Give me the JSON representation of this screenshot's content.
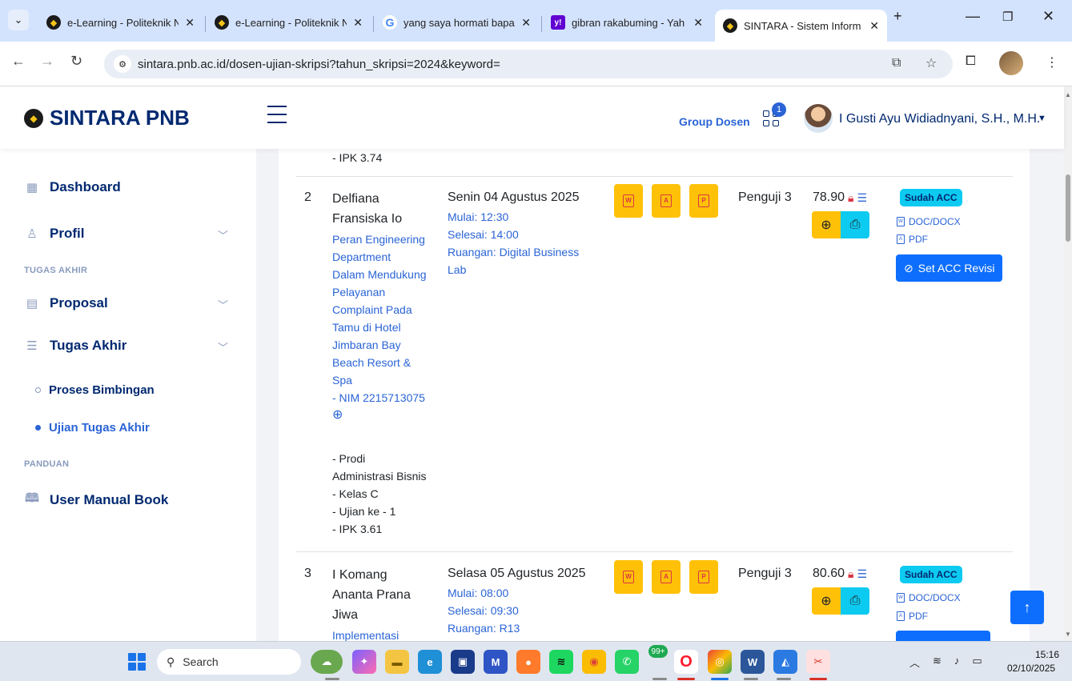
{
  "browser": {
    "tabs": [
      {
        "title": "e-Learning - Politeknik N",
        "icon": "pnb-logo-icon"
      },
      {
        "title": "e-Learning - Politeknik N",
        "icon": "pnb-logo-icon"
      },
      {
        "title": "yang saya hormati bapak",
        "icon": "google-icon"
      },
      {
        "title": "gibran rakabuming - Yah",
        "icon": "yahoo-icon"
      },
      {
        "title": "SINTARA - Sistem Inform",
        "icon": "pnb-logo-icon"
      }
    ],
    "url": "sintara.pnb.ac.id/dosen-ujian-skripsi?tahun_skripsi=2024&keyword="
  },
  "header": {
    "brand": "SINTARA PNB",
    "group": "Group Dosen",
    "notif_count": "1",
    "user_name": "I Gusti Ayu Widiadnyani, S.H., M.H."
  },
  "sidebar": {
    "items": [
      {
        "label": "Dashboard"
      },
      {
        "label": "Profil"
      },
      {
        "label": "Proposal"
      },
      {
        "label": "Tugas Akhir"
      },
      {
        "label": "User Manual Book"
      }
    ],
    "headings": [
      "TUGAS AKHIR",
      "PANDUAN"
    ],
    "sub_items": [
      {
        "label": "Proses Bimbingan"
      },
      {
        "label": "Ujian Tugas Akhir"
      }
    ]
  },
  "table": {
    "prev_tail": "- IPK 3.74",
    "rows": [
      {
        "no": "2",
        "name": [
          "Delfiana",
          "Fransiska Io"
        ],
        "thesis": [
          "Peran Engineering",
          "Department",
          "Dalam Mendukung",
          "Pelayanan",
          "Complaint Pada",
          "Tamu di Hotel",
          "Jimbaran Bay",
          "Beach Resort &",
          "Spa"
        ],
        "nim": "- NIM 2215713075",
        "details": [
          "- Prodi",
          "Administrasi Bisnis",
          "- Kelas C",
          "- Ujian ke - 1",
          "- IPK 3.61"
        ],
        "date": "Senin 04 Agustus 2025",
        "start": "Mulai: 12:30",
        "end": "Selesai: 14:00",
        "room": [
          "Ruangan: Digital Business",
          "Lab"
        ],
        "role": "Penguji 3",
        "score": "78.90",
        "status": "Sudah ACC",
        "doc_label": "DOC/DOCX",
        "pdf_label": "PDF",
        "action": "Set ACC Revisi"
      },
      {
        "no": "3",
        "name": [
          "I Komang",
          "Ananta Prana",
          "Jiwa"
        ],
        "thesis": [
          "Implementasi"
        ],
        "date": "Selasa 05 Agustus 2025",
        "start": "Mulai: 08:00",
        "end": "Selesai: 09:30",
        "room": [
          "Ruangan: R13"
        ],
        "role": "Penguji 3",
        "score": "80.60",
        "status": "Sudah ACC",
        "doc_label": "DOC/DOCX",
        "pdf_label": "PDF"
      }
    ]
  },
  "taskbar": {
    "search": "Search",
    "badge": "99+",
    "time": "15:16",
    "date": "02/10/2025"
  },
  "colors": {
    "brand_navy": "#012970",
    "link_blue": "#2a64d6",
    "warning": "#ffc107",
    "info": "#0dcaf0",
    "primary": "#0d6efd"
  }
}
